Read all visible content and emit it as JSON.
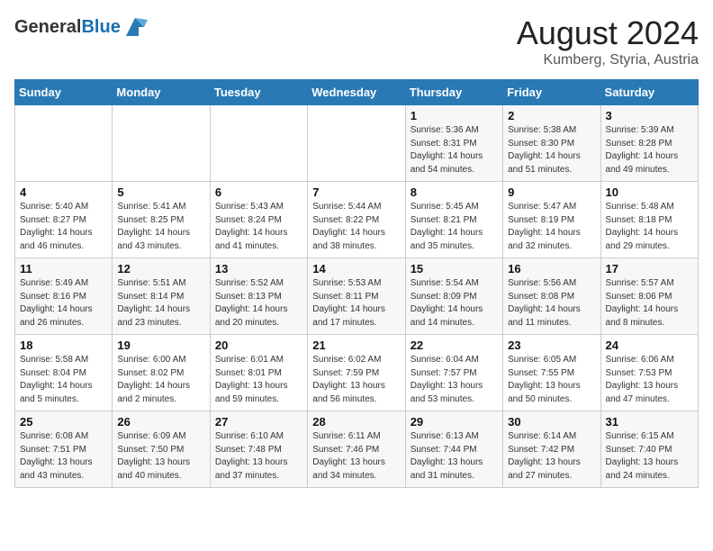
{
  "header": {
    "logo_general": "General",
    "logo_blue": "Blue",
    "title": "August 2024",
    "location": "Kumberg, Styria, Austria"
  },
  "days_of_week": [
    "Sunday",
    "Monday",
    "Tuesday",
    "Wednesday",
    "Thursday",
    "Friday",
    "Saturday"
  ],
  "weeks": [
    [
      {
        "day": "",
        "info": ""
      },
      {
        "day": "",
        "info": ""
      },
      {
        "day": "",
        "info": ""
      },
      {
        "day": "",
        "info": ""
      },
      {
        "day": "1",
        "info": "Sunrise: 5:36 AM\nSunset: 8:31 PM\nDaylight: 14 hours\nand 54 minutes."
      },
      {
        "day": "2",
        "info": "Sunrise: 5:38 AM\nSunset: 8:30 PM\nDaylight: 14 hours\nand 51 minutes."
      },
      {
        "day": "3",
        "info": "Sunrise: 5:39 AM\nSunset: 8:28 PM\nDaylight: 14 hours\nand 49 minutes."
      }
    ],
    [
      {
        "day": "4",
        "info": "Sunrise: 5:40 AM\nSunset: 8:27 PM\nDaylight: 14 hours\nand 46 minutes."
      },
      {
        "day": "5",
        "info": "Sunrise: 5:41 AM\nSunset: 8:25 PM\nDaylight: 14 hours\nand 43 minutes."
      },
      {
        "day": "6",
        "info": "Sunrise: 5:43 AM\nSunset: 8:24 PM\nDaylight: 14 hours\nand 41 minutes."
      },
      {
        "day": "7",
        "info": "Sunrise: 5:44 AM\nSunset: 8:22 PM\nDaylight: 14 hours\nand 38 minutes."
      },
      {
        "day": "8",
        "info": "Sunrise: 5:45 AM\nSunset: 8:21 PM\nDaylight: 14 hours\nand 35 minutes."
      },
      {
        "day": "9",
        "info": "Sunrise: 5:47 AM\nSunset: 8:19 PM\nDaylight: 14 hours\nand 32 minutes."
      },
      {
        "day": "10",
        "info": "Sunrise: 5:48 AM\nSunset: 8:18 PM\nDaylight: 14 hours\nand 29 minutes."
      }
    ],
    [
      {
        "day": "11",
        "info": "Sunrise: 5:49 AM\nSunset: 8:16 PM\nDaylight: 14 hours\nand 26 minutes."
      },
      {
        "day": "12",
        "info": "Sunrise: 5:51 AM\nSunset: 8:14 PM\nDaylight: 14 hours\nand 23 minutes."
      },
      {
        "day": "13",
        "info": "Sunrise: 5:52 AM\nSunset: 8:13 PM\nDaylight: 14 hours\nand 20 minutes."
      },
      {
        "day": "14",
        "info": "Sunrise: 5:53 AM\nSunset: 8:11 PM\nDaylight: 14 hours\nand 17 minutes."
      },
      {
        "day": "15",
        "info": "Sunrise: 5:54 AM\nSunset: 8:09 PM\nDaylight: 14 hours\nand 14 minutes."
      },
      {
        "day": "16",
        "info": "Sunrise: 5:56 AM\nSunset: 8:08 PM\nDaylight: 14 hours\nand 11 minutes."
      },
      {
        "day": "17",
        "info": "Sunrise: 5:57 AM\nSunset: 8:06 PM\nDaylight: 14 hours\nand 8 minutes."
      }
    ],
    [
      {
        "day": "18",
        "info": "Sunrise: 5:58 AM\nSunset: 8:04 PM\nDaylight: 14 hours\nand 5 minutes."
      },
      {
        "day": "19",
        "info": "Sunrise: 6:00 AM\nSunset: 8:02 PM\nDaylight: 14 hours\nand 2 minutes."
      },
      {
        "day": "20",
        "info": "Sunrise: 6:01 AM\nSunset: 8:01 PM\nDaylight: 13 hours\nand 59 minutes."
      },
      {
        "day": "21",
        "info": "Sunrise: 6:02 AM\nSunset: 7:59 PM\nDaylight: 13 hours\nand 56 minutes."
      },
      {
        "day": "22",
        "info": "Sunrise: 6:04 AM\nSunset: 7:57 PM\nDaylight: 13 hours\nand 53 minutes."
      },
      {
        "day": "23",
        "info": "Sunrise: 6:05 AM\nSunset: 7:55 PM\nDaylight: 13 hours\nand 50 minutes."
      },
      {
        "day": "24",
        "info": "Sunrise: 6:06 AM\nSunset: 7:53 PM\nDaylight: 13 hours\nand 47 minutes."
      }
    ],
    [
      {
        "day": "25",
        "info": "Sunrise: 6:08 AM\nSunset: 7:51 PM\nDaylight: 13 hours\nand 43 minutes."
      },
      {
        "day": "26",
        "info": "Sunrise: 6:09 AM\nSunset: 7:50 PM\nDaylight: 13 hours\nand 40 minutes."
      },
      {
        "day": "27",
        "info": "Sunrise: 6:10 AM\nSunset: 7:48 PM\nDaylight: 13 hours\nand 37 minutes."
      },
      {
        "day": "28",
        "info": "Sunrise: 6:11 AM\nSunset: 7:46 PM\nDaylight: 13 hours\nand 34 minutes."
      },
      {
        "day": "29",
        "info": "Sunrise: 6:13 AM\nSunset: 7:44 PM\nDaylight: 13 hours\nand 31 minutes."
      },
      {
        "day": "30",
        "info": "Sunrise: 6:14 AM\nSunset: 7:42 PM\nDaylight: 13 hours\nand 27 minutes."
      },
      {
        "day": "31",
        "info": "Sunrise: 6:15 AM\nSunset: 7:40 PM\nDaylight: 13 hours\nand 24 minutes."
      }
    ]
  ]
}
